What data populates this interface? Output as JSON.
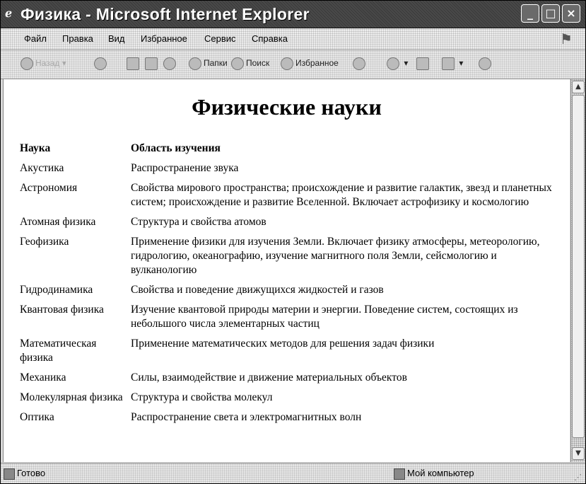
{
  "window": {
    "title": "Физика - Microsoft Internet Explorer",
    "minimize_symbol": "_",
    "maximize_symbol": "□",
    "close_symbol": "×"
  },
  "menu": [
    {
      "label": "Файл",
      "icon": null
    },
    {
      "label": "Правка"
    },
    {
      "label": "Вид"
    },
    {
      "label": "Избранное"
    },
    {
      "label": "Сервис"
    },
    {
      "label": "Справка"
    }
  ],
  "toolbar": {
    "back_label": "Назад",
    "folders_label": "Папки",
    "search_label": "Поиск",
    "favorites_label": "Избранное"
  },
  "page": {
    "heading": "Физические науки",
    "table": {
      "headers": [
        "Наука",
        "Область изучения"
      ],
      "rows": [
        [
          "Акустика",
          "Распространение звука"
        ],
        [
          "Астрономия",
          "Свойства мирового пространства; происхождение и развитие галактик, звезд и планетных систем; происхождение и развитие Вселенной. Включает астрофизику и космологию"
        ],
        [
          "Атомная физика",
          "Структура и свойства атомов"
        ],
        [
          "Геофизика",
          "Применение физики для изучения Земли. Включает физику атмосферы, метеорологию, гидрологию, океанографию, изучение магнитного поля Земли, сейсмологию и вулканологию"
        ],
        [
          "Гидродинамика",
          "Свойства и поведение движущихся жидкостей и газов"
        ],
        [
          "Квантовая физика",
          "Изучение квантовой природы материи и энергии. Поведение систем, состоящих из небольшого числа элементарных частиц"
        ],
        [
          "Математическая физика",
          "Применение математических методов для решения задач физики"
        ],
        [
          "Механика",
          "Силы, взаимодействие и движение материальных объектов"
        ],
        [
          "Молекулярная физика",
          "Структура и свойства молекул"
        ],
        [
          "Оптика",
          "Распространение света и электромагнитных волн"
        ]
      ]
    }
  },
  "status": {
    "left": "Готово",
    "right": "Мой компьютер"
  }
}
